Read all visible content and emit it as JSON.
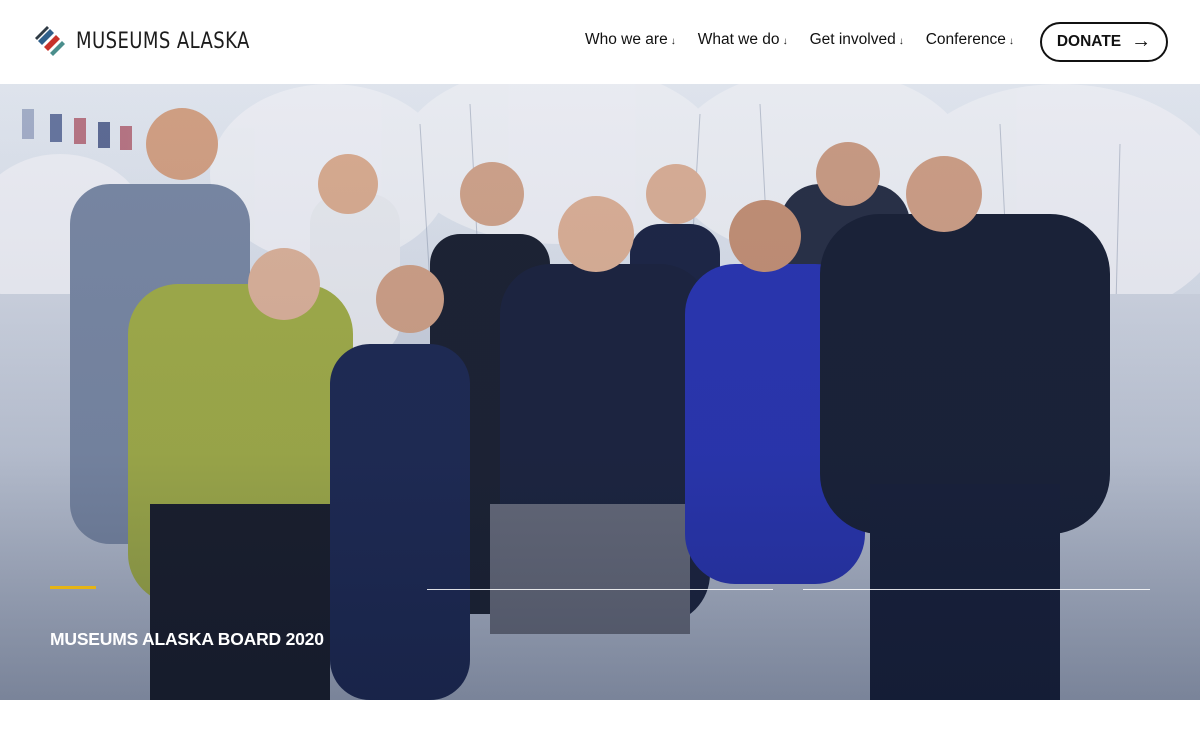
{
  "brand": {
    "name": "MUSEUMS ALASKA",
    "colors": {
      "red": "#c8322b",
      "blue": "#2f5f8a",
      "teal": "#4a8e8c",
      "gold": "#e6b414"
    }
  },
  "nav": {
    "items": [
      {
        "label": "Who we are",
        "icon": "arrow-down-icon"
      },
      {
        "label": "What we do",
        "icon": "arrow-down-icon"
      },
      {
        "label": "Get involved",
        "icon": "arrow-down-icon"
      },
      {
        "label": "Conference",
        "icon": "arrow-down-icon"
      }
    ],
    "arrow_glyph": "↓"
  },
  "donate": {
    "label": "DONATE",
    "icon": "arrow-right-icon",
    "arrow_glyph": "→"
  },
  "hero": {
    "caption": "MUSEUMS ALASKA BOARD 2020",
    "slides_total": 3,
    "active_slide": 1
  }
}
